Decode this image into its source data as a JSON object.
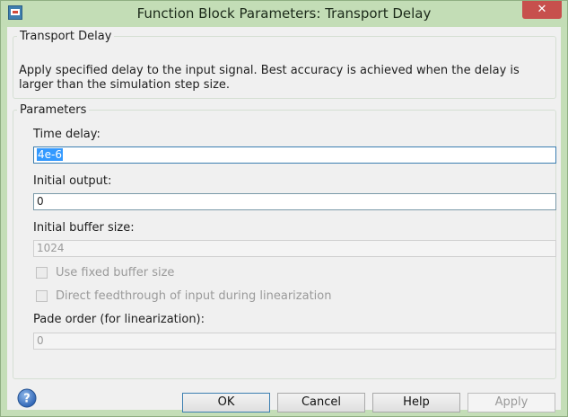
{
  "window": {
    "title": "Function Block Parameters: Transport Delay",
    "close_glyph": "✕"
  },
  "block": {
    "group_title": "Transport Delay",
    "description": "Apply specified delay to the input signal.  Best accuracy is achieved when the delay is larger than the simulation step size."
  },
  "parameters": {
    "group_title": "Parameters",
    "time_delay": {
      "label": "Time delay:",
      "value": "4e-6"
    },
    "initial_output": {
      "label": "Initial output:",
      "value": "0"
    },
    "initial_buffer_size": {
      "label": "Initial buffer size:",
      "value": "1024"
    },
    "use_fixed_buffer": {
      "label": "Use fixed buffer size",
      "checked": false
    },
    "direct_feedthrough": {
      "label": "Direct feedthrough of input during linearization",
      "checked": false
    },
    "pade_order": {
      "label": "Pade order (for linearization):",
      "value": "0"
    }
  },
  "buttons": {
    "ok": "OK",
    "cancel": "Cancel",
    "help": "Help",
    "apply": "Apply"
  },
  "icons": {
    "app": "simulink-block-icon",
    "help": "help-question-icon",
    "close": "close-icon"
  },
  "colors": {
    "frame": "#c4deb7",
    "close_button": "#c7504d",
    "selection": "#3399ff",
    "content_bg": "#f0f0f0"
  }
}
